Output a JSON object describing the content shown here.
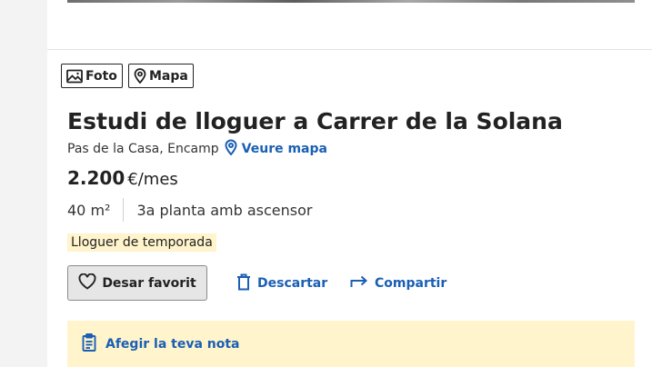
{
  "media_tabs": [
    {
      "label": "Foto",
      "icon": "image-icon"
    },
    {
      "label": "Mapa",
      "icon": "map-pin-icon"
    }
  ],
  "listing": {
    "title": "Estudi de lloguer a Carrer de la Solana",
    "location": "Pas de la Casa, Encamp",
    "map_link": "Veure mapa",
    "price": "2.200",
    "price_unit": "€/mes",
    "features": [
      "40 m²",
      "3a planta amb ascensor"
    ],
    "tag": "Lloguer de temporada"
  },
  "actions": {
    "save": "Desar favorit",
    "discard": "Descartar",
    "share": "Compartir"
  },
  "note": {
    "label": "Afegir la teva nota"
  },
  "colors": {
    "link": "#1a5fb4",
    "highlight_bg": "#fff4cc",
    "button_bg": "#e6e6e6",
    "text": "#222222"
  }
}
